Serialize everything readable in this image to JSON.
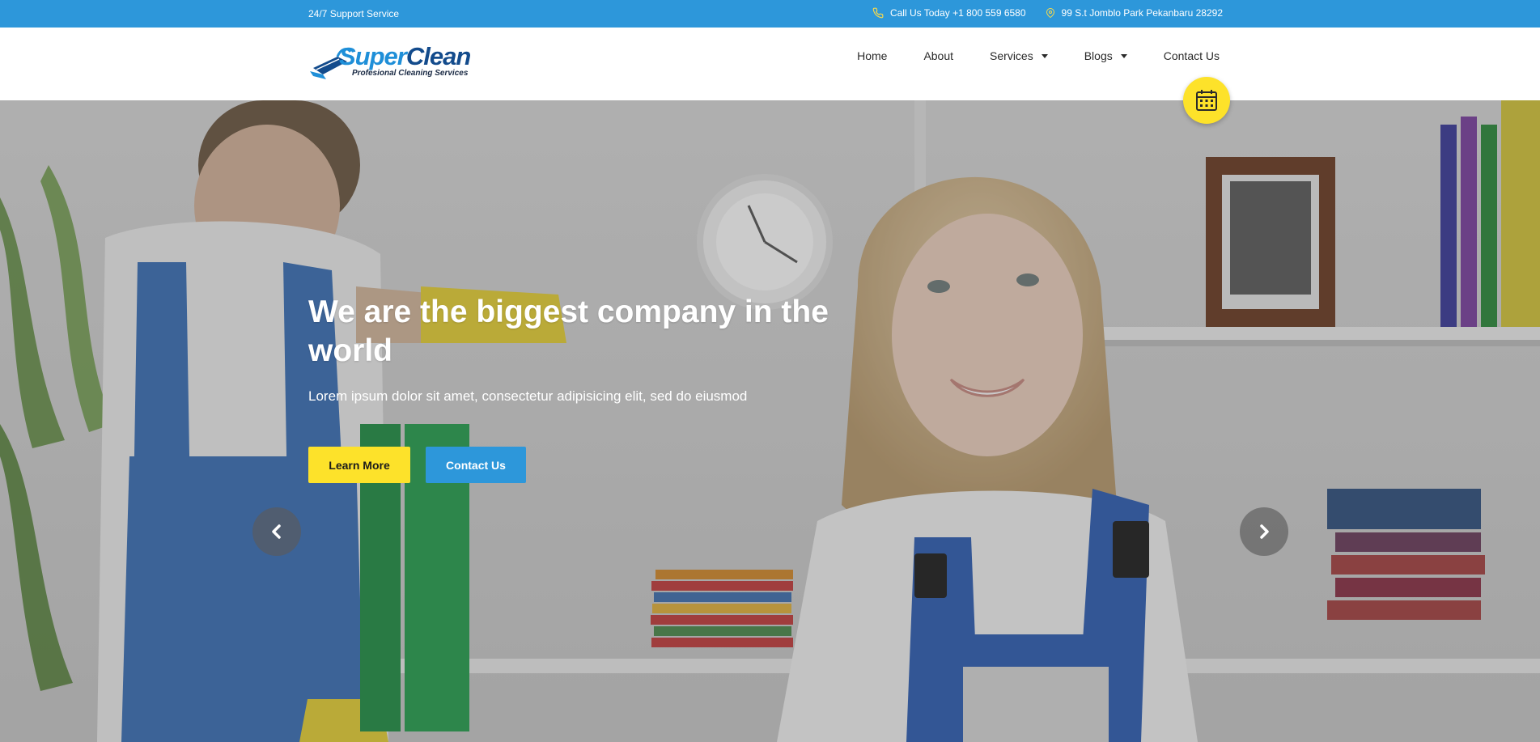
{
  "topbar": {
    "support": "24/7 Support Service",
    "phone": "Call Us Today +1 800 559 6580",
    "address": "99 S.t Jomblo Park Pekanbaru 28292"
  },
  "logo": {
    "brand_super": "Super",
    "brand_clean": "Clean",
    "tagline": "Profesional Cleaning Services"
  },
  "nav": {
    "items": [
      {
        "label": "Home"
      },
      {
        "label": "About"
      },
      {
        "label": "Services"
      },
      {
        "label": "Blogs"
      },
      {
        "label": "Contact Us"
      }
    ]
  },
  "hero": {
    "title": "We are the biggest company in the world",
    "subtitle": "Lorem ipsum dolor sit amet, consectetur adipisicing elit, sed do eiusmod",
    "learn_more": "Learn More",
    "contact_us": "Contact Us"
  },
  "icons": {
    "phone": "phone-icon",
    "location": "map-pin-icon",
    "calendar": "calendar-icon",
    "prev": "chevron-left-icon",
    "next": "chevron-right-icon"
  },
  "colors": {
    "primary_blue": "#2d97da",
    "accent_yellow": "#fde22a"
  }
}
